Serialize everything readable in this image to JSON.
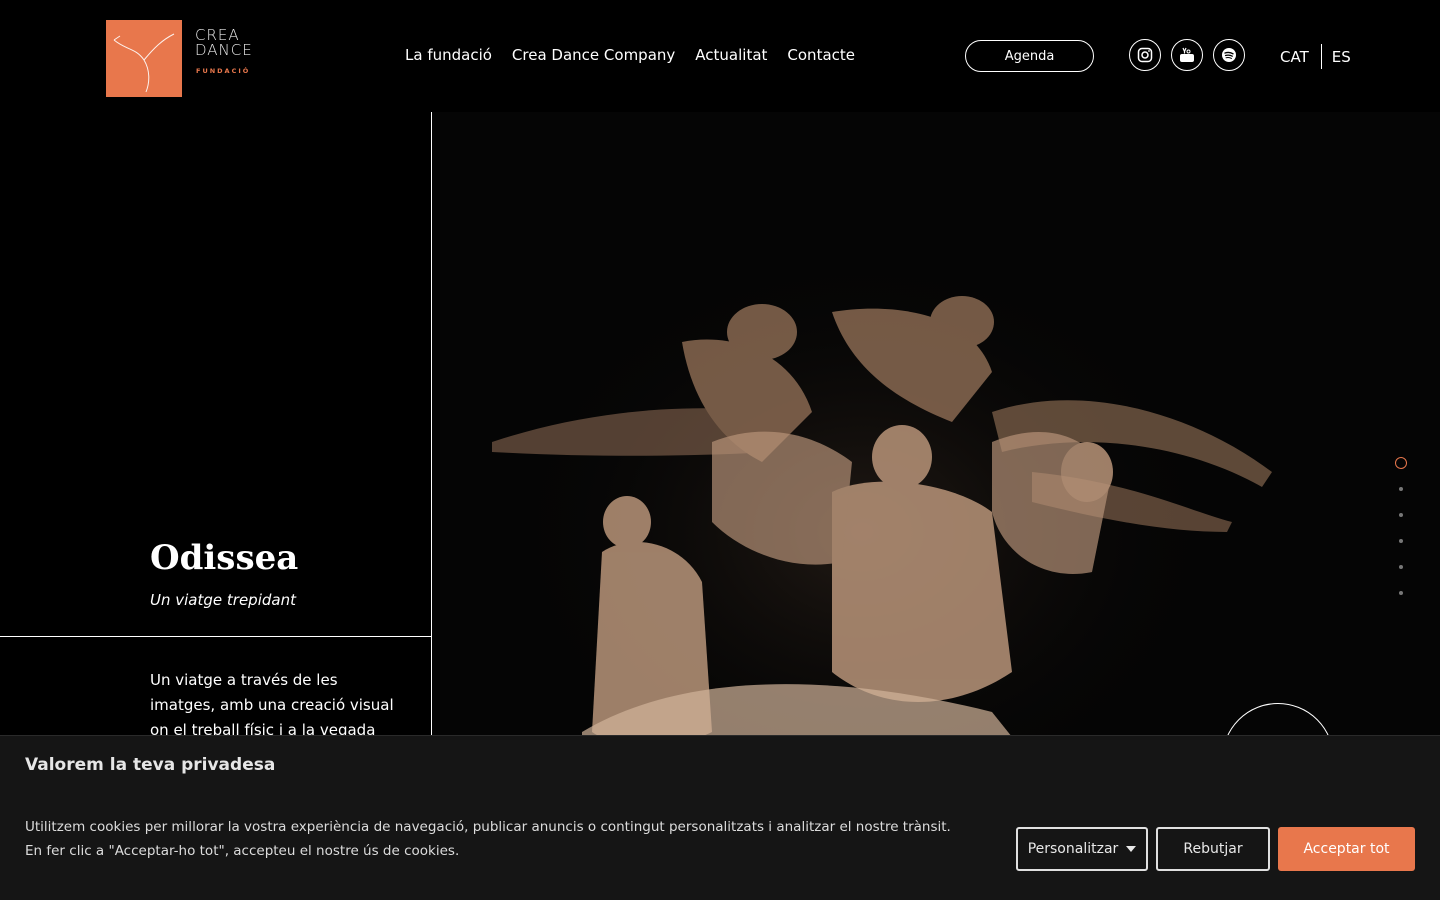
{
  "brand": {
    "logo_word_1": "CREA",
    "logo_word_2": "DANCE",
    "logo_sub": "FUNDACIÓ",
    "accent_color": "#e8774c"
  },
  "nav": {
    "items": [
      {
        "label": "La fundació"
      },
      {
        "label": "Crea Dance Company"
      },
      {
        "label": "Actualitat"
      },
      {
        "label": "Contacte"
      }
    ],
    "agenda_label": "Agenda",
    "social": [
      {
        "icon": "instagram-icon"
      },
      {
        "icon": "youtube-icon"
      },
      {
        "icon": "spotify-icon"
      }
    ],
    "languages": [
      {
        "code": "CAT",
        "active": true
      },
      {
        "code": "ES",
        "active": false
      }
    ]
  },
  "slide": {
    "title": "Odissea",
    "subtitle": "Un viatge trepidant",
    "description": "Un viatge a través de les imatges, amb una creació visual on el treball físic i a la vegada poètic",
    "slide_count": 6,
    "active_index": 0
  },
  "cookie": {
    "title": "Valorem la teva privadesa",
    "text": "Utilitzem cookies per millorar la vostra experiència de navegació, publicar anuncis o contingut personalitzats i analitzar el nostre trànsit. En fer clic a \"Acceptar-ho tot\", accepteu el nostre ús de cookies.",
    "customize_label": "Personalitzar",
    "reject_label": "Rebutjar",
    "accept_label": "Acceptar tot"
  }
}
